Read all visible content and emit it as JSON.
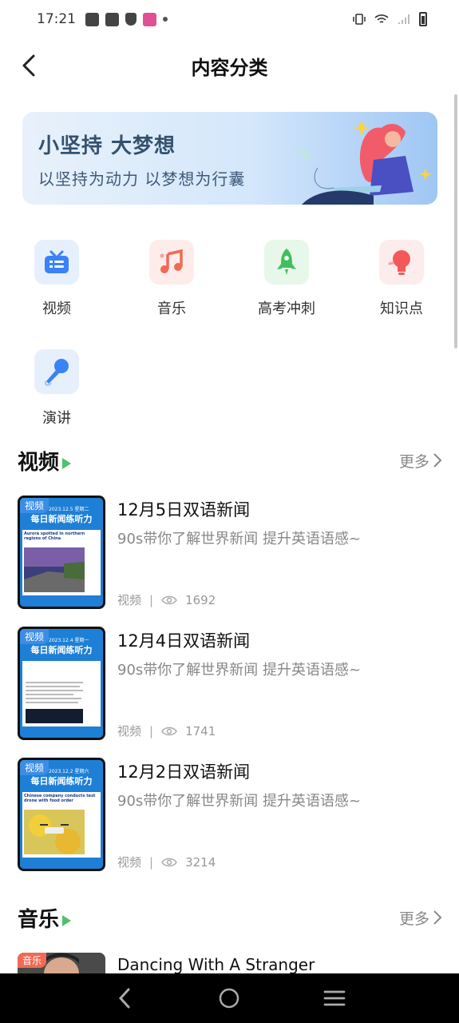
{
  "status_bar": {
    "time": "17:21"
  },
  "header": {
    "title": "内容分类"
  },
  "banner": {
    "title": "小坚持 大梦想",
    "subtitle": "以坚持为动力 以梦想为行囊"
  },
  "categories": [
    {
      "label": "视频",
      "icon": "tv-icon",
      "color": "#3b82f6",
      "bg": "#e6f0fd"
    },
    {
      "label": "音乐",
      "icon": "music-note-icon",
      "color": "#f06a55",
      "bg": "#fdecea"
    },
    {
      "label": "高考冲刺",
      "icon": "rocket-icon",
      "color": "#3fbf5f",
      "bg": "#e7f7ea"
    },
    {
      "label": "知识点",
      "icon": "lightbulb-icon",
      "color": "#f25a5a",
      "bg": "#fdecec"
    },
    {
      "label": "演讲",
      "icon": "microphone-icon",
      "color": "#3b82f6",
      "bg": "#e6f0fd"
    }
  ],
  "video_section": {
    "title": "视频",
    "more": "更多",
    "items": [
      {
        "badge": "视频",
        "thumb_date": "2023.12.5 星期二",
        "thumb_name": "每日新闻练听力",
        "thumb_headline": "Aurora spotted in northern regions of China",
        "title": "12月5日双语新闻",
        "desc": "90s带你了解世界新闻 提升英语语感~",
        "type": "视频",
        "views": "1692"
      },
      {
        "badge": "视频",
        "thumb_date": "2023.12.4 星期一",
        "thumb_name": "每日新闻练听力",
        "thumb_headline": "",
        "title": "12月4日双语新闻",
        "desc": "90s带你了解世界新闻 提升英语语感~",
        "type": "视频",
        "views": "1741"
      },
      {
        "badge": "视频",
        "thumb_date": "2023.12.2 星期六",
        "thumb_name": "每日新闻练听力",
        "thumb_headline": "Chinese company conducts test drone with food order",
        "title": "12月2日双语新闻",
        "desc": "90s带你了解世界新闻 提升英语语感~",
        "type": "视频",
        "views": "3214"
      }
    ]
  },
  "music_section": {
    "title": "音乐",
    "more": "更多",
    "items": [
      {
        "badge": "音乐",
        "title": "Dancing With A Stranger"
      }
    ]
  }
}
